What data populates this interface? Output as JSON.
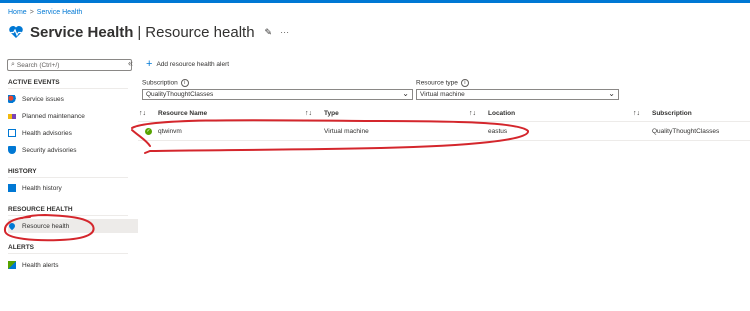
{
  "breadcrumb": {
    "home": "Home",
    "separator": ">",
    "current": "Service Health"
  },
  "header": {
    "title": "Service Health",
    "separator": "|",
    "subtitle": "Resource health",
    "pin_icon": "pin-icon",
    "more": "···"
  },
  "sidebar": {
    "search_placeholder": "Search (Ctrl+/)",
    "collapse": "«",
    "sections": {
      "active_events": "ACTIVE EVENTS",
      "history": "HISTORY",
      "resource_health": "RESOURCE HEALTH",
      "alerts": "ALERTS"
    },
    "items": {
      "service_issues": "Service issues",
      "planned_maintenance": "Planned maintenance",
      "health_advisories": "Health advisories",
      "security_advisories": "Security advisories",
      "health_history": "Health history",
      "resource_health": "Resource health",
      "health_alerts": "Health alerts"
    }
  },
  "toolbar": {
    "add_alert": "Add resource health alert"
  },
  "filters": {
    "subscription_label": "Subscription",
    "subscription_value": "QualityThoughtClasses",
    "resource_type_label": "Resource type",
    "resource_type_value": "Virtual machine",
    "info": "i"
  },
  "table": {
    "sort_icon": "↑↓",
    "columns": {
      "name": "Resource Name",
      "type": "Type",
      "location": "Location",
      "subscription": "Subscription"
    },
    "row": {
      "name": "qtwinvm",
      "type": "Virtual machine",
      "location": "eastus",
      "subscription": "QualityThoughtClasses",
      "status": "healthy"
    }
  },
  "colors": {
    "accent": "#0078d4",
    "healthy": "#57a300",
    "annotation": "#d4262c"
  }
}
